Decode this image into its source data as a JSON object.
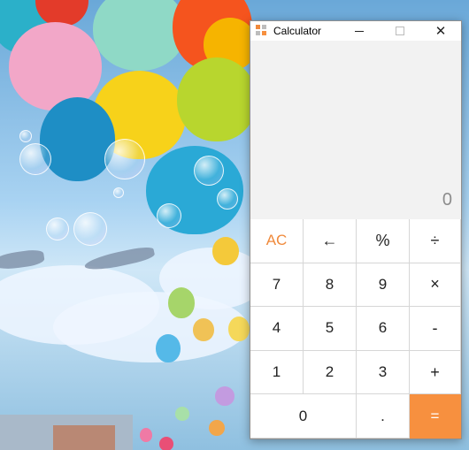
{
  "window": {
    "title": "Calculator",
    "controls": {
      "minimize": "—",
      "maximize": "□",
      "close": "✕"
    }
  },
  "display": {
    "value": "0"
  },
  "keys": [
    {
      "label": "AC",
      "name": "ac-button",
      "cls": "ac"
    },
    {
      "label": "←",
      "name": "backspace-button",
      "cls": "op"
    },
    {
      "label": "%",
      "name": "percent-button",
      "cls": "op"
    },
    {
      "label": "÷",
      "name": "divide-button",
      "cls": "op"
    },
    {
      "label": "7",
      "name": "digit-7-button",
      "cls": ""
    },
    {
      "label": "8",
      "name": "digit-8-button",
      "cls": ""
    },
    {
      "label": "9",
      "name": "digit-9-button",
      "cls": ""
    },
    {
      "label": "×",
      "name": "multiply-button",
      "cls": "op"
    },
    {
      "label": "4",
      "name": "digit-4-button",
      "cls": ""
    },
    {
      "label": "5",
      "name": "digit-5-button",
      "cls": ""
    },
    {
      "label": "6",
      "name": "digit-6-button",
      "cls": ""
    },
    {
      "label": "-",
      "name": "subtract-button",
      "cls": "op"
    },
    {
      "label": "1",
      "name": "digit-1-button",
      "cls": ""
    },
    {
      "label": "2",
      "name": "digit-2-button",
      "cls": ""
    },
    {
      "label": "3",
      "name": "digit-3-button",
      "cls": ""
    },
    {
      "label": "+",
      "name": "add-button",
      "cls": "op"
    },
    {
      "label": "0",
      "name": "digit-0-button",
      "cls": "zero"
    },
    {
      "label": ".",
      "name": "decimal-button",
      "cls": ""
    },
    {
      "label": "=",
      "name": "equals-button",
      "cls": "equals"
    }
  ],
  "colors": {
    "accent": "#f7903f",
    "ac_text": "#f08a3c",
    "display_bg": "#f2f2f2"
  },
  "icons": {
    "app": "calculator-app-icon"
  }
}
